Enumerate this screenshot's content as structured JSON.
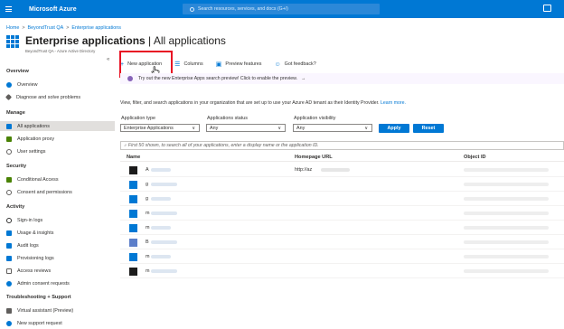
{
  "topbar": {
    "brand": "Microsoft Azure",
    "search_placeholder": "Search resources, services, and docs (G+/)"
  },
  "breadcrumb": {
    "home": "Home",
    "tenant": "BeyondTrust QA",
    "current": "Enterprise applications",
    "sep": ">"
  },
  "header": {
    "title_main": "Enterprise applications",
    "title_rest": " | All applications",
    "subtitle": "BeyondTrust QA - Azure Active Directory",
    "more": "···"
  },
  "sidebar": {
    "collapse": "«",
    "sections": {
      "overview": "Overview",
      "manage": "Manage",
      "security": "Security",
      "activity": "Activity",
      "troubleshooting": "Troubleshooting + Support"
    },
    "items": {
      "overview": "Overview",
      "diagnose": "Diagnose and solve problems",
      "all_apps": "All applications",
      "app_proxy": "Application proxy",
      "user_settings": "User settings",
      "conditional_access": "Conditional Access",
      "consent": "Consent and permissions",
      "signin_logs": "Sign-in logs",
      "usage": "Usage & insights",
      "audit_logs": "Audit logs",
      "provisioning_logs": "Provisioning logs",
      "access_reviews": "Access reviews",
      "admin_consent": "Admin consent requests",
      "virtual_assistant": "Virtual assistant (Preview)",
      "new_support": "New support request"
    }
  },
  "toolbar": {
    "new_app": "New application",
    "columns": "Columns",
    "preview": "Preview features",
    "feedback": "Got feedback?"
  },
  "banner": {
    "text": "Try out the new Enterprise Apps search preview! Click to enable the preview.",
    "arrow": "→"
  },
  "intro": {
    "text": "View, filter, and search applications in your organization that are set up to use your Azure AD tenant as their Identity Provider. ",
    "link": "Learn more."
  },
  "filters": {
    "app_type_label": "Application type",
    "app_type_value": "Enterprise Applications",
    "status_label": "Applications status",
    "status_value": "Any",
    "visibility_label": "Application visibility",
    "visibility_value": "Any",
    "apply": "Apply",
    "reset": "Reset"
  },
  "search": {
    "placeholder": "First 50 shown, to search all of your applications, enter a display name or the application ID."
  },
  "table": {
    "columns": [
      "Name",
      "Homepage URL",
      "Object ID"
    ],
    "rows": [
      {
        "initial": "A",
        "url": "http://az",
        "icon_color": "#1b1b1b"
      },
      {
        "initial": "g",
        "url": "",
        "icon_color": "#0078d4"
      },
      {
        "initial": "g",
        "url": "",
        "icon_color": "#0078d4"
      },
      {
        "initial": "m",
        "url": "",
        "icon_color": "#0078d4"
      },
      {
        "initial": "m",
        "url": "",
        "icon_color": "#0078d4"
      },
      {
        "initial": "B",
        "url": "",
        "icon_color": "#5c7ec9"
      },
      {
        "initial": "m",
        "url": "",
        "icon_color": "#0078d4"
      },
      {
        "initial": "m",
        "url": "",
        "icon_color": "#1b1b1b"
      }
    ]
  }
}
